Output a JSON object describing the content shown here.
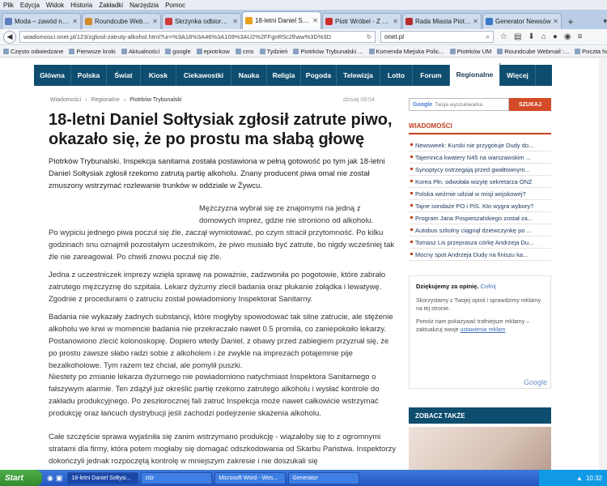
{
  "menubar": [
    "Plik",
    "Edycja",
    "Widok",
    "Historia",
    "Zakładki",
    "Narzędzia",
    "Pomoc"
  ],
  "tabs": [
    {
      "label": "Moda – zawód na cał...",
      "color": "#5b7fc0",
      "active": false
    },
    {
      "label": "Roundcube Webmail :...",
      "color": "#d28a2a",
      "active": false
    },
    {
      "label": "Skrzynka odbiorcza",
      "color": "#cf3a3a",
      "active": false
    },
    {
      "label": "18-letni Daniel Sołtysi...",
      "color": "#e8a018",
      "active": true
    },
    {
      "label": "Piotr Wróbel - Z Minut...",
      "color": "#cc2d2d",
      "active": false
    },
    {
      "label": "Rada Miasta Piotrków...",
      "color": "#b52a2a",
      "active": false
    },
    {
      "label": "Generator Newsów",
      "color": "#3a7ac8",
      "active": false
    }
  ],
  "address": {
    "url": "wiadomosci.onet.pl/123/zglosil-zatruty-alkohol.html?ur=%3A18%3A46%3A109%3AU2%2FFgnR5c2lhaw%3D%3D",
    "search": "onet.pl"
  },
  "bookmarks": [
    "Często odwiedzane",
    "Pierwsze kroki",
    "Aktualności",
    "google",
    "epiotrkow",
    "cms",
    "Tydzień",
    "Piotrków Trybunalski ...",
    "Komenda Miejska Polic...",
    "Piotrków UM",
    "Roundcube Webmail :...",
    "Poczta home.pl"
  ],
  "site_nav": [
    "Główna",
    "Polska",
    "Świat",
    "Kiosk",
    "Ciekawostki",
    "Nauka",
    "Religia",
    "Pogoda",
    "Telewizja",
    "Lotto",
    "Forum",
    "Regionalne",
    "Więcej"
  ],
  "breadcrumb": {
    "a": "Wiadomości",
    "b": "Regionalne",
    "c": "Piotrków Trybunalski",
    "sep": "›"
  },
  "datetime": "dzisiaj 09:54",
  "article": {
    "title": "18-letni Daniel Sołtysiak zgłosił zatrute piwo, okazało się, że po prostu ma słabą głowę",
    "lead": "Piotrków Trybunalski. Inspekcja sanitarna została postawiona w pełną gotowość po tym jak 18-letni Daniel Sołtysiak zgłosił rzekomo zatrutą partię alkoholu. Znany producent piwa omal nie został zmuszony wstrzymać rozlewanie trunków w oddziale w Żywcu.",
    "p1_a": "Mężczyzna wybrał się ze znajomymi na jedną z domowych imprez, gdzie nie stroniono od alkoholu.",
    "p1_b": "Po wypiciu jednego piwa poczuł się źle, zaczął wymiotować, po czym stracił przytomność. Po kilku godzinach snu oznajmił pozostałym uczestnikom, że piwo musiało być zatrute, bo nigdy wcześniej tak źle nie zareagował. Po chwili znowu poczuł się źle.",
    "p2": "Jedna z uczestniczek imprezy wzięła sprawę na poważnie, zadzwoniła po pogotowie, które zabrało zatrutego mężczyznę do szpitala. Lekarz dyżurny zlecił badania oraz płukanie żołądka i lewatywę. Zgodnie z procedurami o zatruciu został powiadomiony Inspektorat Sanitarny.",
    "p3": "Badania nie wykazały żadnych substancji, które mogłyby spowodować tak silne zatrucie, ale stężenie alkoholu we krwi w momencie badania nie przekraczało nawet 0.5 promila, co zaniepokoiło lekarzy. Postanowiono zlecić kolonoskopię. Dopiero wtedy Daniel, z obawy przed zabiegiem przyznał się, że po prostu zawsze słabo radzi sobie z alkoholem i że zwykle na imprezach potajemnie pije bezalkoholowe. Tym razem też chciał, ale pomylił puszki.",
    "p4": "Niestety po zmianie lekarza dyżurnego nie powiadomiono natychmiast Inspektora Sanitarnego o fałszywym alarmie. Ten zdążył już określić partię rzekomo zatrutego alkoholu i wysłać kontrole do zakładu produkcyjnego. Po zeszłorocznej fali zatruć Inspekcja może nawet całkowicie wstrzymać produkcję oraz łańcuch dystrybucji jeśli zachodzi podejrzenie skażenia alkoholu.",
    "p5": "Całe szczęście sprawa wyjaśniła się zanim wstrzymano produkcję - wiązałoby się to z ogromnymi stratami dla firmy, która potem mogłaby się domagać odszkodowania od Skarbu Państwa. Inspektorzy dokończyli jednak rozpoczętą kontrolę w mniejszym zakresie i nie doszukali się"
  },
  "sidebar": {
    "search_placeholder": "Twoja wyszukiwarka",
    "search_brand": "Google",
    "search_button": "SZUKAJ",
    "news_heading": "WIADOMOŚCI",
    "news": [
      "Newsweek: Kurski nie przygotuje Dudy do...",
      "Tajemnica kwatery N45 na warszawskim ...",
      "Synoptycy ostrzegają przed gwałtownym...",
      "Korea Płn. odwołała wizytę sekretarza ONZ",
      "Polska weźmie udział w misji wojskowej?",
      "Tajne sondaże PO i PiS. Kto wygra wybory?",
      "Program Jana Pospieszalskiego został za...",
      "Autobus szkolny ciągnął dziewczynkę po ...",
      "Tomasz Lis przeprasza córkę Andrzeja Du...",
      "Mocny spot Andrzeja Dudy na finiszu ka..."
    ],
    "ad_thanks_bold": "Dziękujemy za opinię.",
    "ad_undo": "Cofnij",
    "ad_text1": "Skorzystamy z Twojej opinii i sprawdzimy reklamy na tej stronie.",
    "ad_text2": "Pomóż nam pokazywać trafniejsze reklamy – zaktualizuj swoje",
    "ad_link": "ustawienia reklam",
    "google_logo": "Google",
    "see_also": "ZOBACZ TAKŻE"
  },
  "taskbar": {
    "start": "Start",
    "items": [
      "18-letni Daniel Sołtysi...",
      "zdz",
      "Microsoft Word - Wes...",
      "Generator"
    ],
    "time": "10:32"
  }
}
